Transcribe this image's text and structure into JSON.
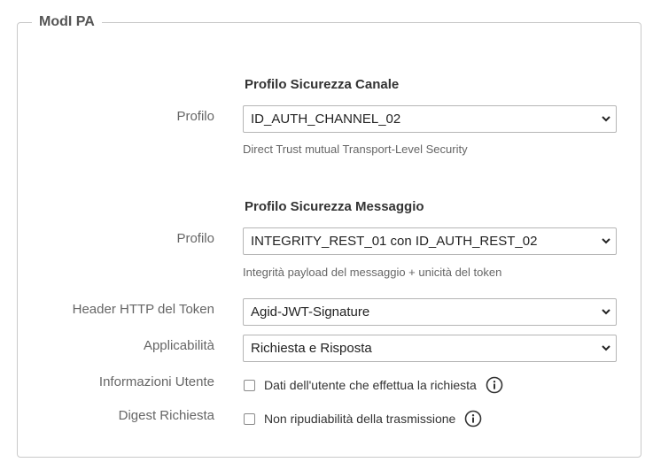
{
  "fieldset": {
    "legend": "ModI PA"
  },
  "canale": {
    "title": "Profilo Sicurezza Canale",
    "profilo_label": "Profilo",
    "profilo_value": "ID_AUTH_CHANNEL_02",
    "profilo_help": "Direct Trust mutual Transport-Level Security"
  },
  "messaggio": {
    "title": "Profilo Sicurezza Messaggio",
    "profilo_label": "Profilo",
    "profilo_value": "INTEGRITY_REST_01 con ID_AUTH_REST_02",
    "profilo_help": "Integrità payload del messaggio + unicità del token",
    "header_label": "Header HTTP del Token",
    "header_value": "Agid-JWT-Signature",
    "applicabilita_label": "Applicabilità",
    "applicabilita_value": "Richiesta e Risposta",
    "info_utente_label": "Informazioni Utente",
    "info_utente_checkbox": "Dati dell'utente che effettua la richiesta",
    "info_utente_checked": false,
    "digest_label": "Digest Richiesta",
    "digest_checkbox": "Non ripudiabilità della trasmissione",
    "digest_checked": false
  },
  "icons": {
    "select_arrow": "chevron-down-icon",
    "info": "info-icon"
  }
}
